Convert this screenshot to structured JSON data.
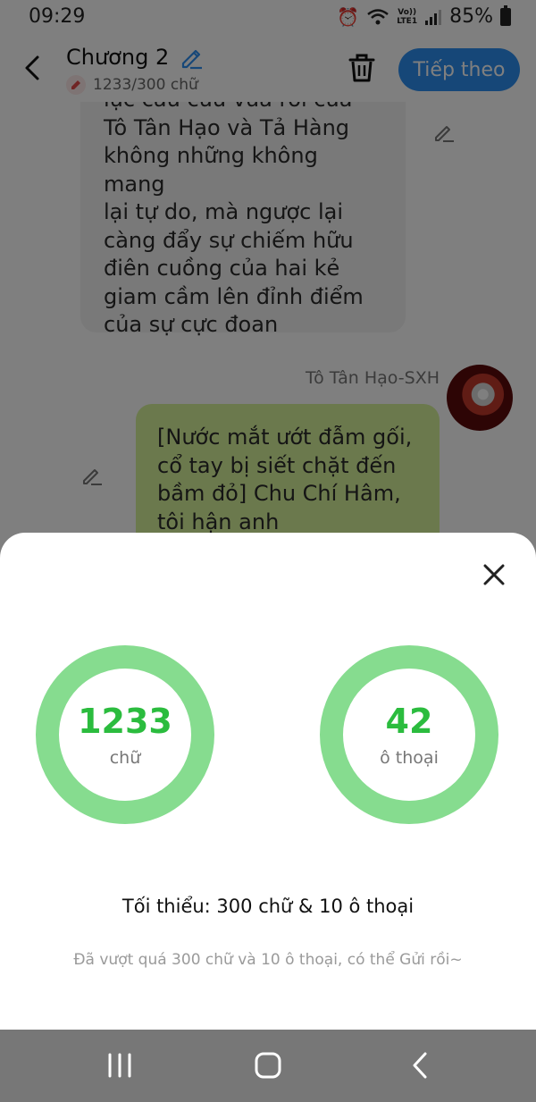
{
  "status_bar": {
    "time": "09:29",
    "network_label": "Vo))\nLTE1",
    "battery": "85%"
  },
  "header": {
    "title": "Chương 2",
    "word_count": "1233/300 chữ",
    "next_label": "Tiếp theo"
  },
  "chat": {
    "left_bubble": {
      "lines": [
        "lực cầu cứu vừa rồi của",
        "Tô Tân Hạo và Tả Hàng",
        "không những không mang",
        "lại tự do, mà ngược lại",
        "càng đẩy sự chiếm hữu",
        "điên cuồng của hai kẻ",
        "giam cầm lên đỉnh điểm",
        "của sự cực đoan"
      ]
    },
    "sender_name": "Tô Tân Hạo-SXH",
    "right_bubble": {
      "lines": [
        "[Nước mắt ướt đẫm gối,",
        "cổ tay bị siết chặt đến",
        "bầm đỏ] Chu Chí Hâm,",
        "tôi hận anh"
      ]
    }
  },
  "sheet": {
    "words": {
      "value": "1233",
      "label": "chữ"
    },
    "dialogs": {
      "value": "42",
      "label": "ô thoại"
    },
    "minimum": "Tối thiểu: 300 chữ & 10 ô thoại",
    "hint": "Đã vượt quá 300 chữ và 10 ô thoại, có thể Gửi rồi~"
  },
  "colors": {
    "accent_blue": "#2d8ff0",
    "ring_green": "#86dc8f",
    "value_green": "#2bbc3e",
    "bubble_green": "#d7f29a",
    "nav_bar": "#777777"
  },
  "icons": {
    "back": "back-arrow-icon",
    "title_edit": "pencil-icon",
    "trash": "trash-icon",
    "close": "close-icon",
    "recents": "recents-icon",
    "home": "home-icon",
    "nav_back": "nav-back-icon"
  }
}
